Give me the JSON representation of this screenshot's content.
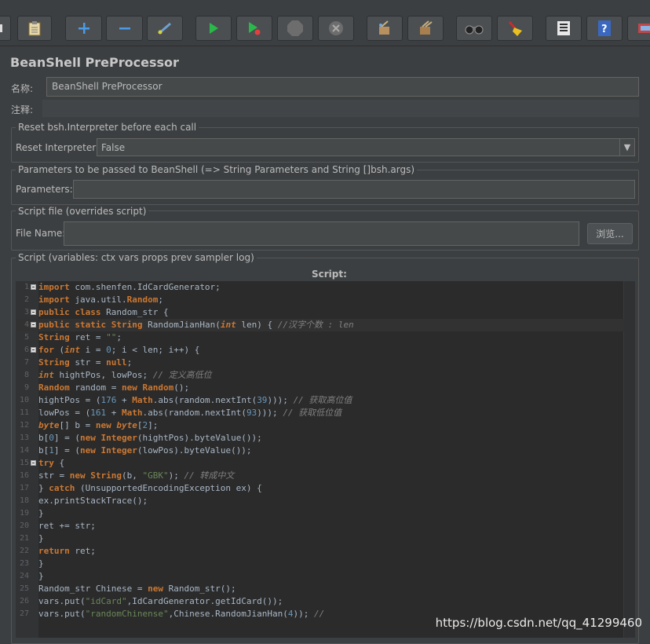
{
  "toolbar": {
    "buttons": [
      {
        "name": "partial-left-icon"
      },
      {
        "name": "clipboard-icon"
      },
      {
        "name": "add-icon"
      },
      {
        "name": "remove-icon"
      },
      {
        "name": "toggle-icon"
      },
      {
        "name": "start-icon"
      },
      {
        "name": "start-no-pause-icon"
      },
      {
        "name": "stop-icon"
      },
      {
        "name": "shutdown-icon"
      },
      {
        "name": "clear-icon"
      },
      {
        "name": "clear-all-icon"
      },
      {
        "name": "binoculars-icon"
      },
      {
        "name": "broom-icon"
      },
      {
        "name": "list-icon"
      },
      {
        "name": "help-icon"
      },
      {
        "name": "remote-icon"
      }
    ]
  },
  "panel": {
    "title": "BeanShell PreProcessor",
    "name_label": "名称:",
    "name_value": "BeanShell PreProcessor",
    "comment_label": "注释:",
    "comment_value": ""
  },
  "reset_group": {
    "title": "Reset bsh.Interpreter before each call",
    "label": "Reset Interpreter:",
    "value": "False",
    "arrow": "▼"
  },
  "params_group": {
    "title": "Parameters to be passed to BeanShell (=> String Parameters and String []bsh.args)",
    "label": "Parameters:",
    "value": ""
  },
  "file_group": {
    "title": "Script file (overrides script)",
    "label": "File Name:",
    "value": "",
    "browse_label": "浏览..."
  },
  "script_group": {
    "title": "Script (variables: ctx vars props prev sampler log)",
    "header": "Script:"
  },
  "code": {
    "lines": [
      {
        "n": "1",
        "fold": true,
        "text": "import com.shenfen.IdCardGenerator;"
      },
      {
        "n": "2",
        "fold": false,
        "text": "import java.util.Random;"
      },
      {
        "n": "3",
        "fold": true,
        "text": "public class Random_str {"
      },
      {
        "n": "4",
        "fold": true,
        "text": "public static String RandomJianHan(int len) { //汉字个数 : len"
      },
      {
        "n": "5",
        "fold": false,
        "text": "String ret = \"\";"
      },
      {
        "n": "6",
        "fold": true,
        "text": "for (int i = 0; i < len; i++) {"
      },
      {
        "n": "7",
        "fold": false,
        "text": "String str = null;"
      },
      {
        "n": "8",
        "fold": false,
        "text": "int hightPos, lowPos; // 定义高低位"
      },
      {
        "n": "9",
        "fold": false,
        "text": "Random random = new Random();"
      },
      {
        "n": "10",
        "fold": false,
        "text": "hightPos = (176 + Math.abs(random.nextInt(39))); // 获取高位值"
      },
      {
        "n": "11",
        "fold": false,
        "text": "lowPos = (161 + Math.abs(random.nextInt(93))); // 获取低位值"
      },
      {
        "n": "12",
        "fold": false,
        "text": "byte[] b = new byte[2];"
      },
      {
        "n": "13",
        "fold": false,
        "text": "b[0] = (new Integer(hightPos).byteValue());"
      },
      {
        "n": "14",
        "fold": false,
        "text": "b[1] = (new Integer(lowPos).byteValue());"
      },
      {
        "n": "15",
        "fold": true,
        "text": "try {"
      },
      {
        "n": "16",
        "fold": false,
        "text": "str = new String(b, \"GBK\"); // 转成中文"
      },
      {
        "n": "17",
        "fold": false,
        "text": "} catch (UnsupportedEncodingException ex) {"
      },
      {
        "n": "18",
        "fold": false,
        "text": "ex.printStackTrace();"
      },
      {
        "n": "19",
        "fold": false,
        "text": "}"
      },
      {
        "n": "20",
        "fold": false,
        "text": "ret += str;"
      },
      {
        "n": "21",
        "fold": false,
        "text": "}"
      },
      {
        "n": "22",
        "fold": false,
        "text": "return ret;"
      },
      {
        "n": "23",
        "fold": false,
        "text": "}"
      },
      {
        "n": "24",
        "fold": false,
        "text": "}"
      },
      {
        "n": "25",
        "fold": false,
        "text": "Random_str Chinese = new Random_str();"
      },
      {
        "n": "26",
        "fold": false,
        "text": "vars.put(\"idCard\",IdCardGenerator.getIdCard());"
      },
      {
        "n": "27",
        "fold": false,
        "text": "vars.put(\"randomChinense\",Chinese.RandomJianHan(4)); //"
      }
    ]
  },
  "watermark": "https://blog.csdn.net/qq_41299460"
}
